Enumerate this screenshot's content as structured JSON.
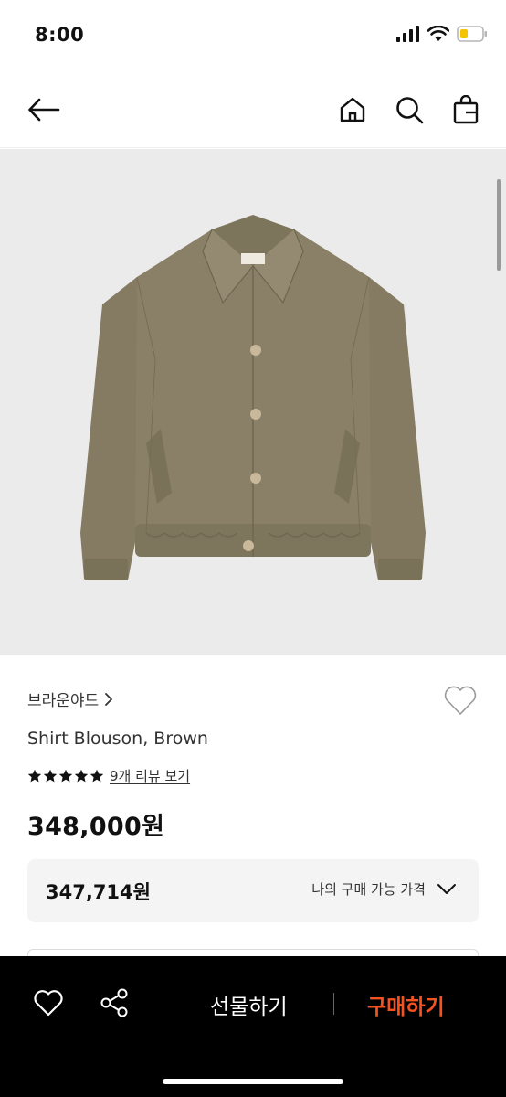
{
  "status_bar": {
    "time": "8:00"
  },
  "nav": {
    "icons": [
      "back-arrow-icon",
      "home-icon",
      "search-icon",
      "shopping-bag-icon"
    ]
  },
  "product": {
    "brand": "브라운야드",
    "brand_chevron": "›",
    "name": "Shirt Blouson, Brown",
    "rating_stars": 5,
    "review_link": "9개 리뷰 보기",
    "price": "348,000원",
    "my_price": {
      "value": "347,714원",
      "label": "나의 구매 가능 가격"
    }
  },
  "bottom_bar": {
    "gift_label": "선물하기",
    "buy_label": "구매하기"
  },
  "colors": {
    "accent": "#f4521f",
    "image_bg": "#ebebeb",
    "jacket": "#8a8068",
    "bottom_bar_bg": "#000000"
  }
}
